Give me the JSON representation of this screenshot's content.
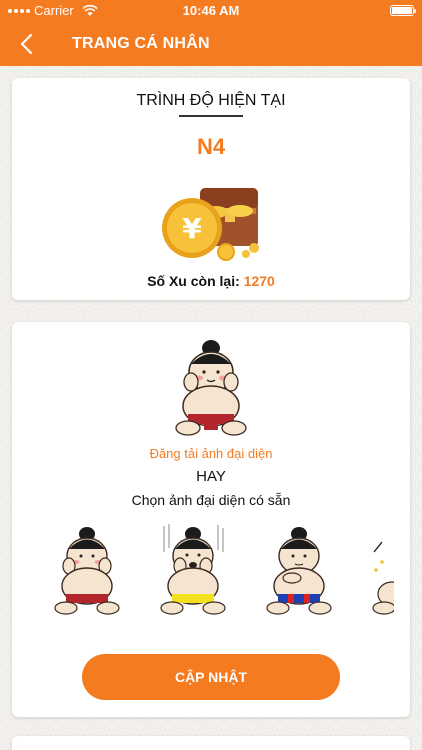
{
  "status": {
    "carrier": "Carrier",
    "time": "10:46 AM"
  },
  "nav": {
    "title": "TRANG CÁ NHÂN",
    "back_icon": "chevron-left-icon"
  },
  "level": {
    "title": "TRÌNH ĐỘ HIỆN TẠI",
    "value": "N4"
  },
  "coins": {
    "label": "Số Xu còn lại: ",
    "value": "1270",
    "icon": "coins-treasure-icon"
  },
  "avatar_section": {
    "upload_label": "Đăng tải ảnh đại diện",
    "or_label": "HAY",
    "choose_label": "Chọn ảnh đại diện có sẵn",
    "options": [
      {
        "name": "sumo-avatar-1",
        "belt": "#b3262b"
      },
      {
        "name": "sumo-avatar-2",
        "belt": "#f3e01f"
      },
      {
        "name": "sumo-avatar-3",
        "belt": "#1f3fb3"
      },
      {
        "name": "sumo-avatar-4",
        "belt": "#b3262b"
      }
    ]
  },
  "actions": {
    "update_label": "CẬP NHẬT"
  },
  "colors": {
    "accent": "#f47b20",
    "background": "#f3f1ee",
    "card": "#ffffff"
  }
}
